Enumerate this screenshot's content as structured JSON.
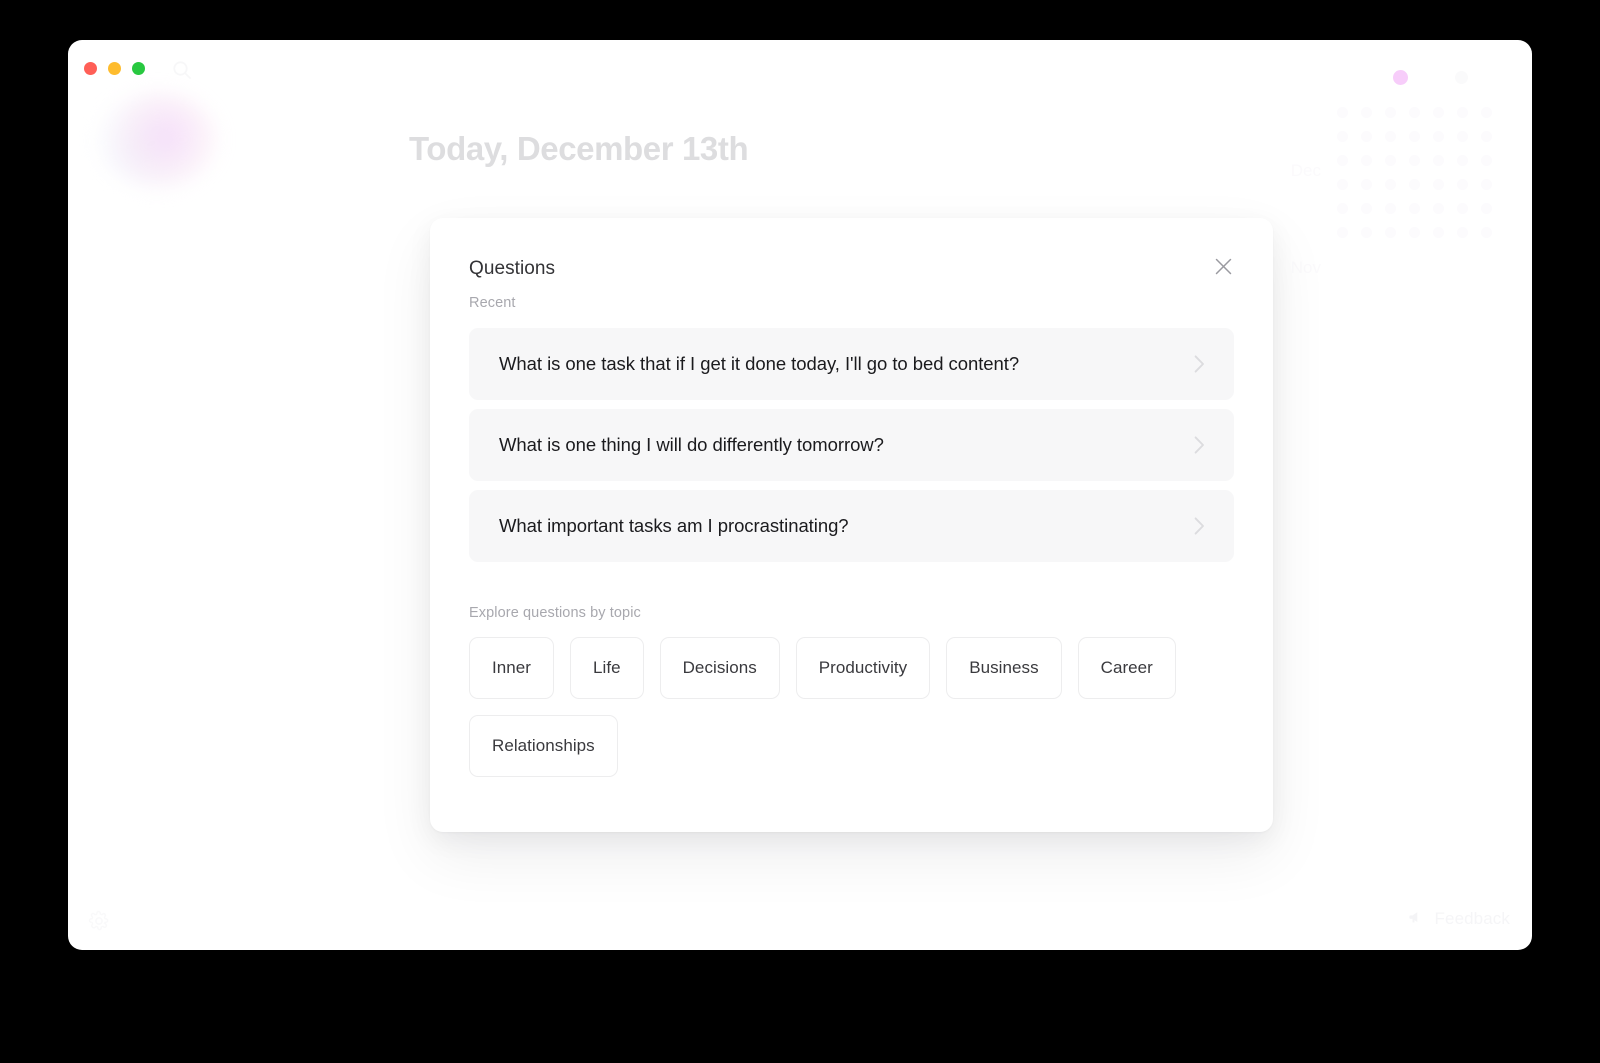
{
  "window": {
    "traffic_lights": [
      {
        "name": "close",
        "color": "#ff5f57"
      },
      {
        "name": "minimize",
        "color": "#febc2e"
      },
      {
        "name": "maximize",
        "color": "#28c840"
      }
    ],
    "search_icon": "search-icon"
  },
  "background": {
    "page_title": "Today, December 13th",
    "activity": {
      "month_labels": [
        "Dec",
        "Nov"
      ],
      "rows": 6,
      "columns": 7,
      "highlight_color": "#f7cdfa"
    },
    "settings_icon": "gear-icon",
    "feedback": {
      "icon": "megaphone-icon",
      "label": "Feedback"
    }
  },
  "modal": {
    "title": "Questions",
    "close_icon": "close-icon",
    "recent_label": "Recent",
    "questions": [
      {
        "text": "What is one task that if I get it done today, I'll go to bed content?",
        "chevron": "chevron-right-icon"
      },
      {
        "text": "What is one thing I will do differently tomorrow?",
        "chevron": "chevron-right-icon"
      },
      {
        "text": "What important tasks am I procrastinating?",
        "chevron": "chevron-right-icon"
      }
    ],
    "topics_label": "Explore questions by topic",
    "topics": [
      "Inner",
      "Life",
      "Decisions",
      "Productivity",
      "Business",
      "Career",
      "Relationships"
    ]
  }
}
